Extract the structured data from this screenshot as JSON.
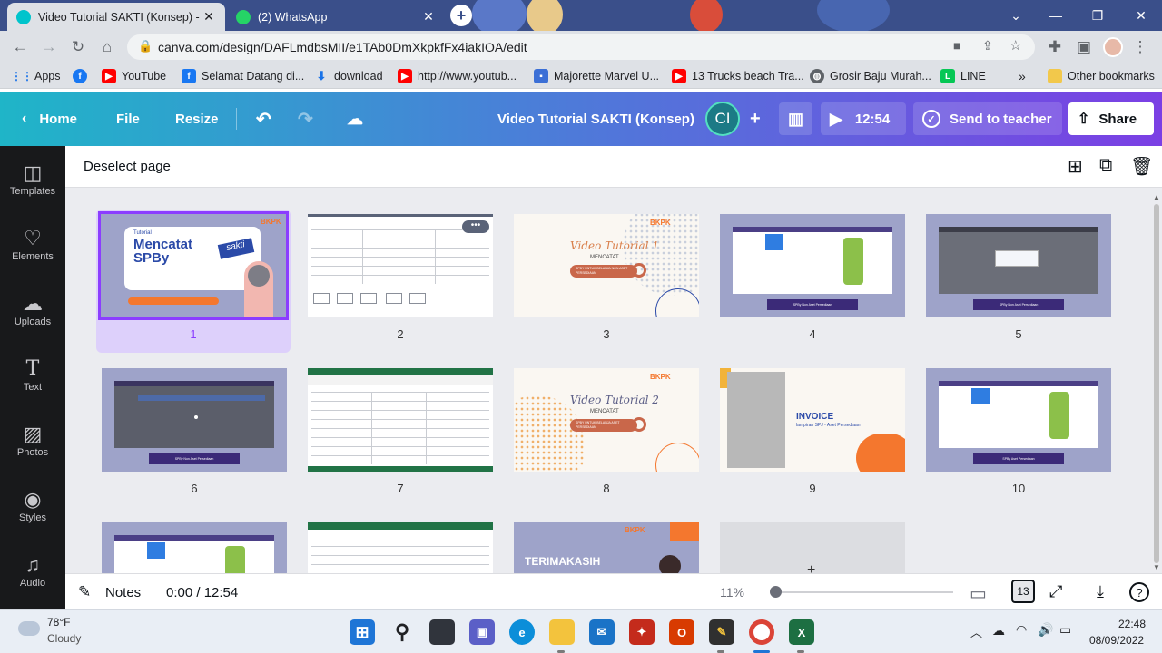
{
  "browser": {
    "tabs": [
      {
        "title": "Video Tutorial SAKTI (Konsep) - V",
        "active": true
      },
      {
        "title": "(2) WhatsApp",
        "active": false
      }
    ],
    "new_tab": "+",
    "url": "canva.com/design/DAFLmdbsMII/e1TAb0DmXkpkfFx4iakIOA/edit",
    "profile_initial": "",
    "bookmarks": [
      {
        "label": "Apps"
      },
      {
        "label": ""
      },
      {
        "label": "YouTube"
      },
      {
        "label": "Selamat Datang di..."
      },
      {
        "label": "download"
      },
      {
        "label": "http://www.youtub..."
      },
      {
        "label": "Majorette Marvel U..."
      },
      {
        "label": "13 Trucks beach Tra..."
      },
      {
        "label": "Grosir Baju Murah..."
      },
      {
        "label": "LINE"
      }
    ],
    "more_bookmarks": "»",
    "other_bookmarks": "Other bookmarks"
  },
  "canva": {
    "header": {
      "home": "Home",
      "file": "File",
      "resize": "Resize",
      "title": "Video Tutorial SAKTI (Konsep)",
      "avatar": "CI",
      "play_time": "12:54",
      "send_to_teacher": "Send to teacher",
      "share": "Share"
    },
    "sidebar": [
      {
        "label": "Templates",
        "icon": "templates-icon"
      },
      {
        "label": "Elements",
        "icon": "elements-icon"
      },
      {
        "label": "Uploads",
        "icon": "uploads-icon"
      },
      {
        "label": "Text",
        "icon": "text-icon"
      },
      {
        "label": "Photos",
        "icon": "photos-icon"
      },
      {
        "label": "Styles",
        "icon": "styles-icon"
      },
      {
        "label": "Audio",
        "icon": "audio-icon"
      }
    ],
    "deselect": "Deselect page",
    "pages": [
      {
        "num": "1",
        "kind": "title1"
      },
      {
        "num": "2",
        "kind": "sheet"
      },
      {
        "num": "3",
        "kind": "video1"
      },
      {
        "num": "4",
        "kind": "app"
      },
      {
        "num": "5",
        "kind": "dialog"
      },
      {
        "num": "6",
        "kind": "dark"
      },
      {
        "num": "7",
        "kind": "excel"
      },
      {
        "num": "8",
        "kind": "video2"
      },
      {
        "num": "9",
        "kind": "invoice"
      },
      {
        "num": "10",
        "kind": "app"
      },
      {
        "num": "",
        "kind": "app"
      },
      {
        "num": "",
        "kind": "excel"
      },
      {
        "num": "",
        "kind": "thanks"
      },
      {
        "num": "",
        "kind": "add"
      }
    ],
    "slide_text": {
      "s1_tutorial": "Tutorial",
      "s1_title_a": "Mencatat",
      "s1_title_b": "SPBy",
      "s1_badge": "sakti",
      "s1_brand": "BKPK",
      "s3_title": "Video Tutorial 1",
      "s3_sub": "MENCATAT",
      "s3_pill": "SPBY UNTUK BELANJA NON ASET PERSEDIAAN",
      "s3_brand": "BKPK",
      "s8_title": "Video Tutorial 2",
      "s8_sub": "MENCATAT",
      "s8_pill": "SPBY UNTUK BELANJA ASET PERSEDIAAN",
      "s8_brand": "BKPK",
      "s9_title": "INVOICE",
      "s9_sub": "lampiran SPJ - Aset Persediaan",
      "s4_bar": "SPBy Non Aset Persediaan",
      "s5_bar": "SPBy Non Aset Persediaan",
      "s6_bar": "SPBy Non Aset Persediaan",
      "s10_bar": "SPBy Aset Persediaan",
      "s13_title": "TERIMAKASIH",
      "s13_brand": "BKPK"
    },
    "bottom": {
      "notes": "Notes",
      "time": "0:00 / 12:54",
      "zoom": "11%",
      "page_count": "13",
      "zoom_level": 0.11
    }
  },
  "taskbar": {
    "temp": "78°F",
    "weather": "Cloudy",
    "time": "22:48",
    "date": "08/09/2022"
  },
  "colors": {
    "accent_purple": "#8b3dff",
    "slide_blue": "#9ea3c9",
    "orange": "#f4772e"
  }
}
